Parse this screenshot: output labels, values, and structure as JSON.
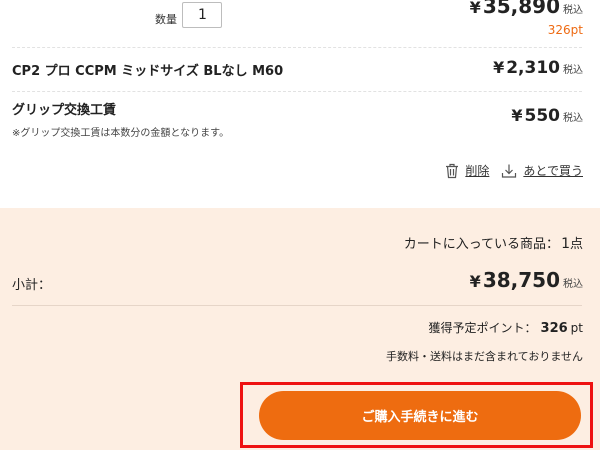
{
  "item": {
    "qty_label": "数量",
    "qty_value": "1",
    "yen_mark": "¥",
    "price": "35,890",
    "tax_label": "税込",
    "points": "326pt"
  },
  "options": [
    {
      "name": "CP2 プロ CCPM ミッドサイズ BLなし M60",
      "price": "2,310",
      "tax": "税込"
    },
    {
      "name": "グリップ交換工賃",
      "note": "※グリップ交換工賃は本数分の金額となります。",
      "price": "550",
      "tax": "税込"
    }
  ],
  "actions": {
    "delete": "削除",
    "save_for_later": "あとで買う"
  },
  "summary": {
    "cart_count_label": "カートに入っている商品：",
    "cart_count_value": "1",
    "cart_count_unit": "点",
    "subtotal_label": "小計：",
    "subtotal_price": "38,750",
    "tax_label": "税込",
    "earn_label": "獲得予定ポイント：",
    "earn_value": "326",
    "earn_unit": "pt",
    "fees_note": "手数料・送料はまだ含まれておりません"
  },
  "checkout_label": "ご購入手続きに進む",
  "colors": {
    "accent": "#ee6c10",
    "summary_bg": "#fdeee2",
    "highlight": "#ee1111"
  },
  "icons": [
    "trash-icon",
    "download-icon"
  ]
}
